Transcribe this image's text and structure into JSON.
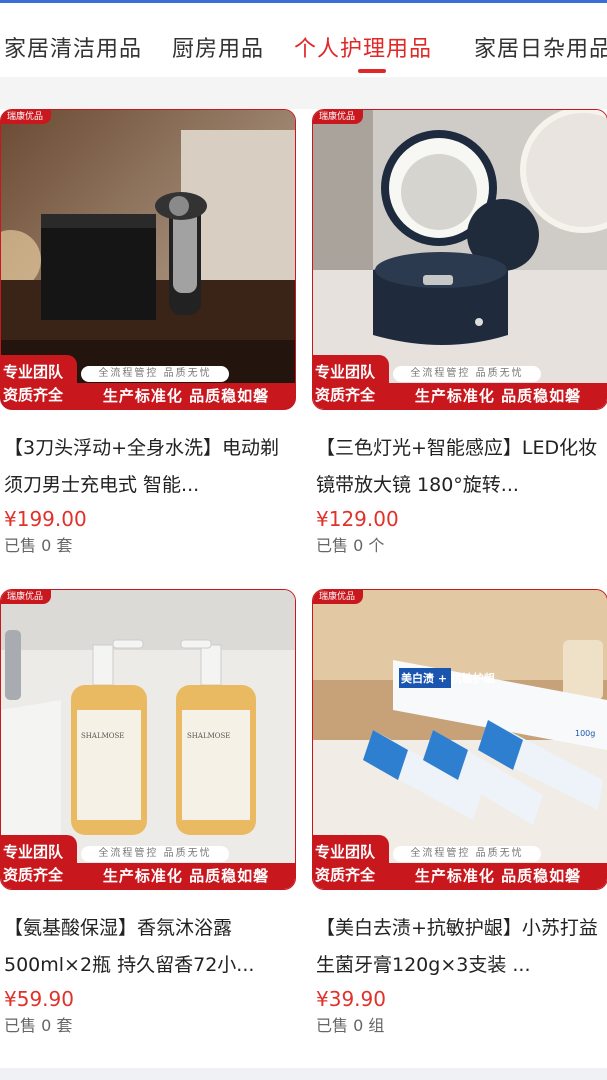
{
  "tabs": [
    {
      "label": "家居清洁用品",
      "active": false
    },
    {
      "label": "厨房用品",
      "active": false
    },
    {
      "label": "个人护理用品",
      "active": true
    },
    {
      "label": "家居日杂用品",
      "active": false
    }
  ],
  "colors": {
    "accent": "#e02828",
    "price": "#e0322b",
    "banner": "#c9171e"
  },
  "banner": {
    "brand": "瑞康优品",
    "left_line1": "专业团队",
    "left_line2": "资质齐全",
    "mid": "全流程管控 品质无忧",
    "strip": "生产标准化 品质稳如磐"
  },
  "products": [
    {
      "title": "【3刀头浮动+全身水洗】电动剃须刀男士充电式 智能...",
      "price": "¥199.00",
      "sold": "已售 0 套",
      "image": "electric-shaver-photo"
    },
    {
      "title": "【三色灯光+智能感应】LED化妆镜带放大镜 180°旋转...",
      "price": "¥129.00",
      "sold": "已售 0 个",
      "image": "led-makeup-mirror-photo"
    },
    {
      "title": "【氨基酸保湿】香氛沐浴露500ml×2瓶 持久留香72小...",
      "price": "¥59.90",
      "sold": "已售 0 套",
      "image": "body-wash-bottles-photo"
    },
    {
      "title": "【美白去渍+抗敏护龈】小苏打益生菌牙膏120g×3支装 ...",
      "price": "¥39.90",
      "sold": "已售 0 组",
      "image": "toothpaste-photo"
    }
  ],
  "image_text": {
    "bottle_brand": "SHALMOSE",
    "toothpaste_box": "美白渍 + 抗敏护龈",
    "toothpaste_weight": "100g"
  }
}
